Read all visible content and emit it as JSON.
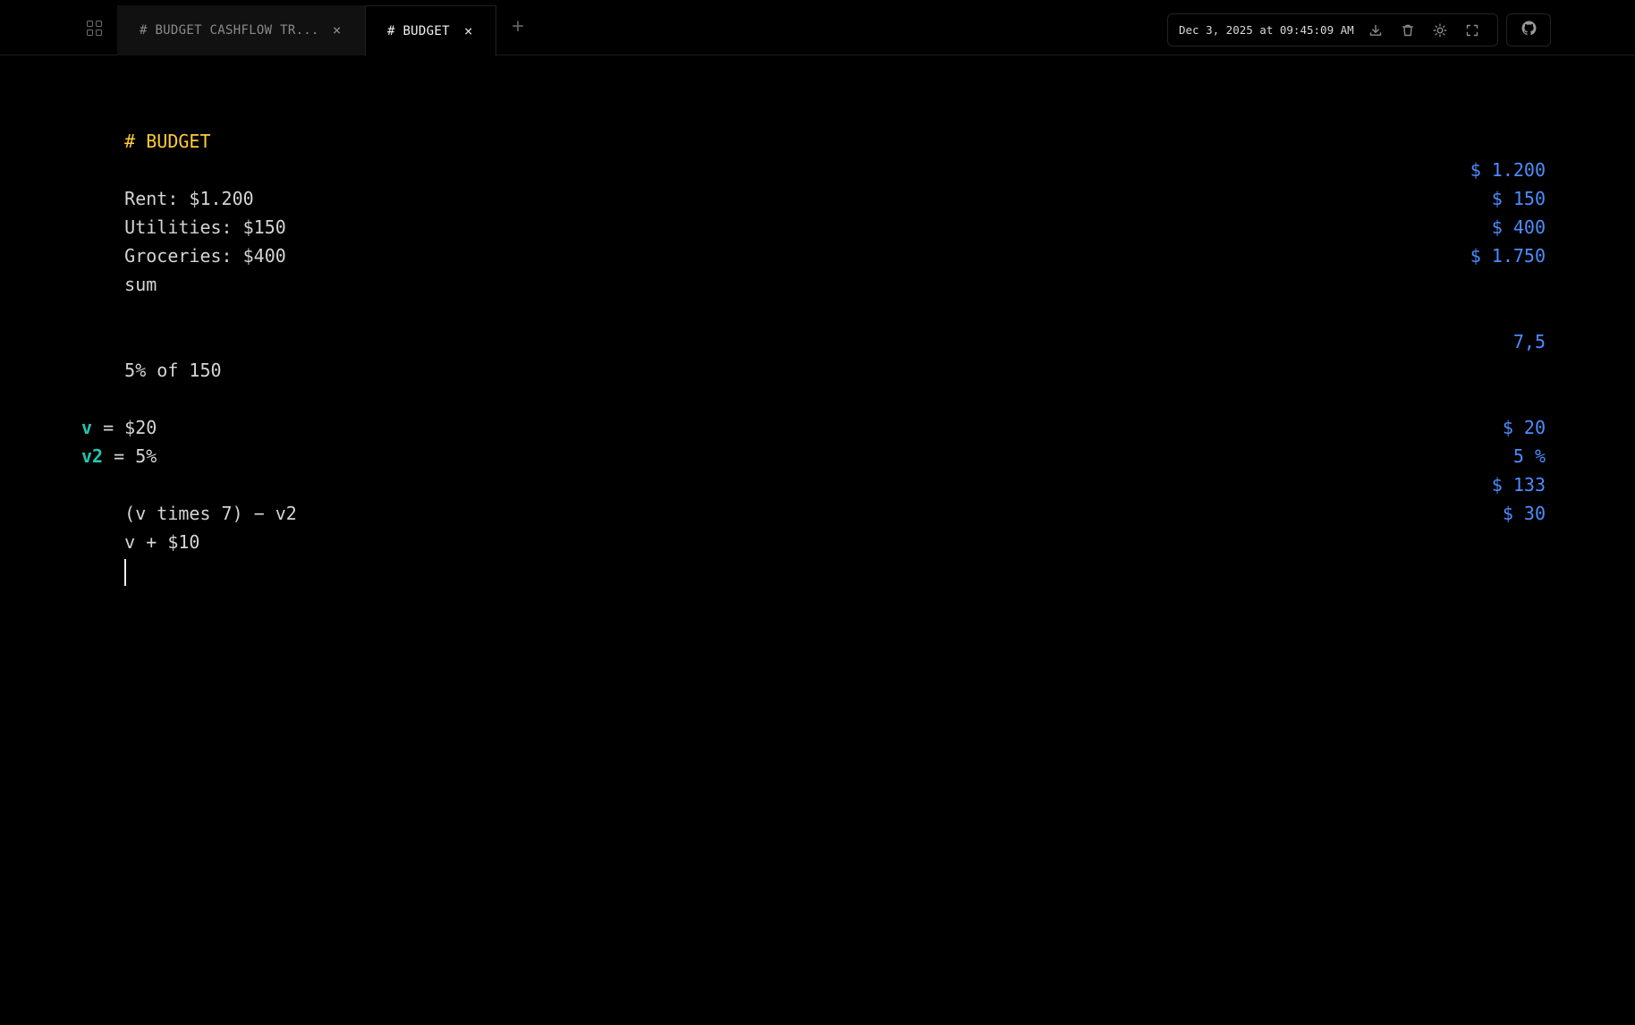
{
  "tabs": [
    {
      "label": "# BUDGET CASHFLOW TR...",
      "close": "×",
      "active": false
    },
    {
      "label": "# BUDGET",
      "close": "×",
      "active": true
    }
  ],
  "new_tab_glyph": "+",
  "toolbar": {
    "timestamp": "Dec 3, 2025 at 09:45:09 AM",
    "icons": [
      "download-icon",
      "trash-icon",
      "sun-icon",
      "fullscreen-icon"
    ]
  },
  "github": {
    "icon": "github-icon"
  },
  "editor": {
    "heading": "# BUDGET",
    "rent": {
      "text": "Rent: $1.200",
      "result": "$ 1.200"
    },
    "utilities": {
      "text": "Utilities: $150",
      "result": "$ 150"
    },
    "groceries": {
      "text": "Groceries: $400",
      "result": "$ 400"
    },
    "sum": {
      "text": "sum",
      "result": "$ 1.750"
    },
    "percent": {
      "text": "5% of 150",
      "result": "7,5"
    },
    "v_def": {
      "var": "v",
      "rest": " = $20",
      "result": "$ 20"
    },
    "v2_def": {
      "var": "v2",
      "rest": " = 5%",
      "result": "5 %"
    },
    "expr1": {
      "text": "(v times 7) − v2",
      "result": "$ 133"
    },
    "expr2": {
      "text": "v + $10",
      "result": "$ 30"
    }
  },
  "colors": {
    "background": "#000000",
    "heading": "#ffcc33",
    "result": "#4c8dff",
    "variable": "#23c6b0",
    "text": "#d4d4d4"
  }
}
